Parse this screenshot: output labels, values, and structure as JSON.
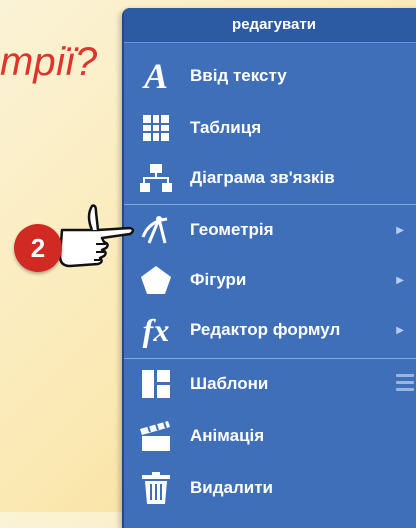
{
  "background": {
    "question_text": "трії?"
  },
  "menu": {
    "header": "редагувати",
    "items": [
      {
        "label": "Ввід тексту",
        "icon": "text-a-icon",
        "submenu": false
      },
      {
        "label": "Таблиця",
        "icon": "table-grid-icon",
        "submenu": false
      },
      {
        "label": "Діаграма зв'язків",
        "icon": "diagram-icon",
        "submenu": false
      },
      {
        "label": "Геометрія",
        "icon": "compass-icon",
        "submenu": true
      },
      {
        "label": "Фігури",
        "icon": "pentagon-icon",
        "submenu": true
      },
      {
        "label": "Редактор формул",
        "icon": "fx-icon",
        "submenu": true
      },
      {
        "label": "Шаблони",
        "icon": "templates-icon",
        "submenu": false
      },
      {
        "label": "Анімація",
        "icon": "clapperboard-icon",
        "submenu": false
      },
      {
        "label": "Видалити",
        "icon": "trash-icon",
        "submenu": false
      }
    ],
    "submenu_arrow": "▶"
  },
  "callout": {
    "step_number": "2"
  },
  "colors": {
    "menu_bg": "#3e6fb8",
    "header_bg": "#2c5aa3",
    "accent_red": "#d12a22",
    "question_red": "#e0332c"
  }
}
